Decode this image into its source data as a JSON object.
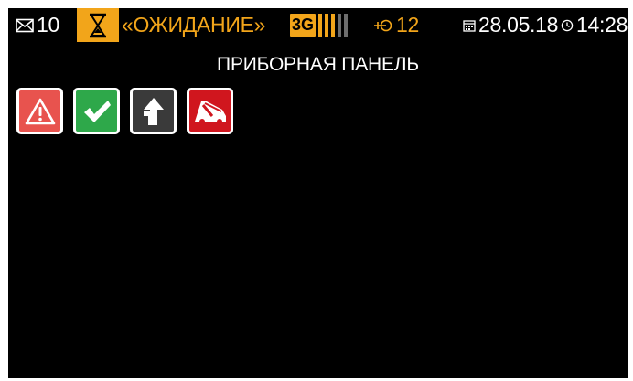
{
  "status": {
    "messages_count": "10",
    "state_text": "«ОЖИДАНИЕ»",
    "network_type": "3G",
    "signal_bars": [
      1,
      1,
      1,
      0,
      0
    ],
    "satellites_count": "12",
    "date": "28.05.18",
    "time": "14:28"
  },
  "panel": {
    "title": "ПРИБОРНАЯ ПАНЕЛЬ",
    "icons": [
      "warning-icon",
      "check-icon",
      "arrow-up-icon",
      "tow-truck-icon"
    ]
  },
  "colors": {
    "accent": "#f2a51a",
    "background": "#000000",
    "text": "#ffffff",
    "warning_tile": "#e8534e",
    "ok_tile": "#2ea84a",
    "neutral_tile": "#3a3a3a",
    "alert_tile": "#d0161e"
  }
}
